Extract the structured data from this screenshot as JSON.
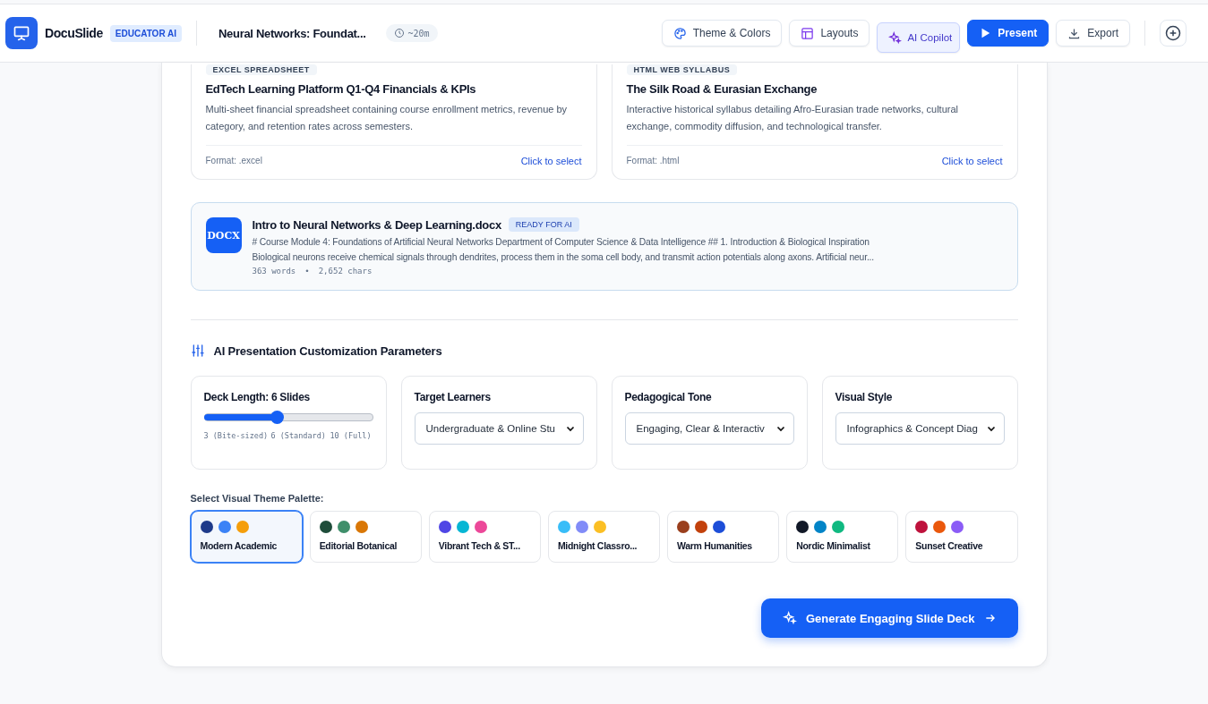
{
  "header": {
    "app_name": "DocuSlide",
    "app_badge": "EDUCATOR AI",
    "deck_title": "Neural Networks: Foundat...",
    "duration": "~20m",
    "actions": [
      {
        "label": "Theme & Colors",
        "kind": "palette",
        "selected": false
      },
      {
        "label": "Layouts",
        "kind": "layout",
        "selected": false
      },
      {
        "label": "AI Copilot",
        "kind": "sparkle",
        "selected": true
      },
      {
        "label": "Present",
        "kind": "play",
        "selected": false
      },
      {
        "label": "Export",
        "kind": "download",
        "selected": false
      }
    ]
  },
  "templates": [
    {
      "badge": "EXCEL SPREADSHEET",
      "title": "EdTech Learning Platform Q1-Q4 Financials & KPIs",
      "description": "Multi-sheet financial spreadsheet containing course enrollment metrics, revenue by category, and retention rates across semesters.",
      "format": "Format: .excel",
      "action": "Click to select"
    },
    {
      "badge": "HTML WEB SYLLABUS",
      "title": "The Silk Road & Eurasian Exchange",
      "description": "Interactive historical syllabus detailing Afro-Eurasian trade networks, cultural exchange, commodity diffusion, and technological transfer.",
      "format": "Format: .html",
      "action": "Click to select"
    }
  ],
  "document": {
    "icon_label": "DOCX",
    "name": "Intro to Neural Networks & Deep Learning.docx",
    "status": "READY FOR AI",
    "preview_lines": [
      "# Course Module 4: Foundations of Artificial Neural Networks Department of Computer Science & Data Intelligence ## 1. Introduction & Biological Inspiration",
      "Biological neurons receive chemical signals through dendrites, process them in the soma cell body, and transmit action potentials along axons. Artificial neur..."
    ],
    "words": "363 words",
    "separator": "•",
    "chars": "2,652 chars"
  },
  "parameters": {
    "heading": "AI Presentation Customization Parameters",
    "deck_length": {
      "label": "Deck Length: 6 Slides",
      "level": 0.43,
      "ticks": [
        "3 (Bite-sized)",
        "6 (Standard)",
        "10 (Full)"
      ]
    },
    "selects": [
      {
        "label": "Target Learners",
        "value": "Undergraduate & Online Stu"
      },
      {
        "label": "Pedagogical Tone",
        "value": "Engaging, Clear & Interactiv"
      },
      {
        "label": "Visual Style",
        "value": "Infographics & Concept Diag"
      }
    ]
  },
  "palette_label": "Select Visual Theme Palette:",
  "palettes": [
    {
      "name": "Modern Academic",
      "selected": true,
      "swatches": [
        {
          "color": "#1e3a8a"
        },
        {
          "color": "#3b82f6"
        },
        {
          "color": "#f59e0b"
        }
      ]
    },
    {
      "name": "Editorial Botanical",
      "selected": false,
      "swatches": [
        {
          "color": "#1f4d3a"
        },
        {
          "color": "#3f8f6b"
        },
        {
          "color": "#d97706"
        }
      ]
    },
    {
      "name": "Vibrant Tech & ST...",
      "selected": false,
      "swatches": [
        {
          "color": "#4f46e5"
        },
        {
          "color": "#06b6d4"
        },
        {
          "color": "#ec4899"
        }
      ]
    },
    {
      "name": "Midnight Classro...",
      "selected": false,
      "swatches": [
        {
          "color": "#38bdf8"
        },
        {
          "color": "#818cf8"
        },
        {
          "color": "#fbbf24"
        }
      ]
    },
    {
      "name": "Warm Humanities",
      "selected": false,
      "swatches": [
        {
          "color": "#9a3f1d"
        },
        {
          "color": "#c2410c"
        },
        {
          "color": "#1d4ed8"
        }
      ]
    },
    {
      "name": "Nordic Minimalist",
      "selected": false,
      "swatches": [
        {
          "color": "#111827"
        },
        {
          "color": "#0284c7"
        },
        {
          "color": "#10b981"
        }
      ]
    },
    {
      "name": "Sunset Creative",
      "selected": false,
      "swatches": [
        {
          "color": "#be123c"
        },
        {
          "color": "#ea580c"
        },
        {
          "color": "#8b5cf6"
        }
      ]
    }
  ],
  "generate_button": "Generate Engaging Slide Deck"
}
